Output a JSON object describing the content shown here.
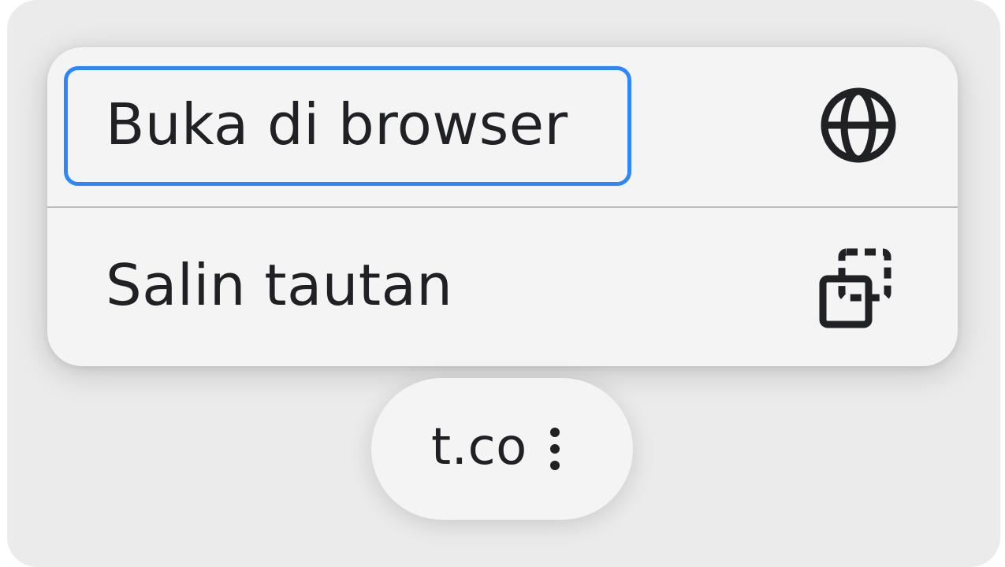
{
  "menu": {
    "items": [
      {
        "label": "Buka di browser",
        "icon": "globe-icon",
        "focused": true
      },
      {
        "label": "Salin tautan",
        "icon": "copy-link-icon",
        "focused": false
      }
    ]
  },
  "chip": {
    "label": "t.co",
    "icon": "more-vertical-icon"
  },
  "colors": {
    "focus_ring": "#2e86fb",
    "menu_background": "#f4f4f4",
    "backdrop": "#ebebeb",
    "text": "#202124"
  }
}
